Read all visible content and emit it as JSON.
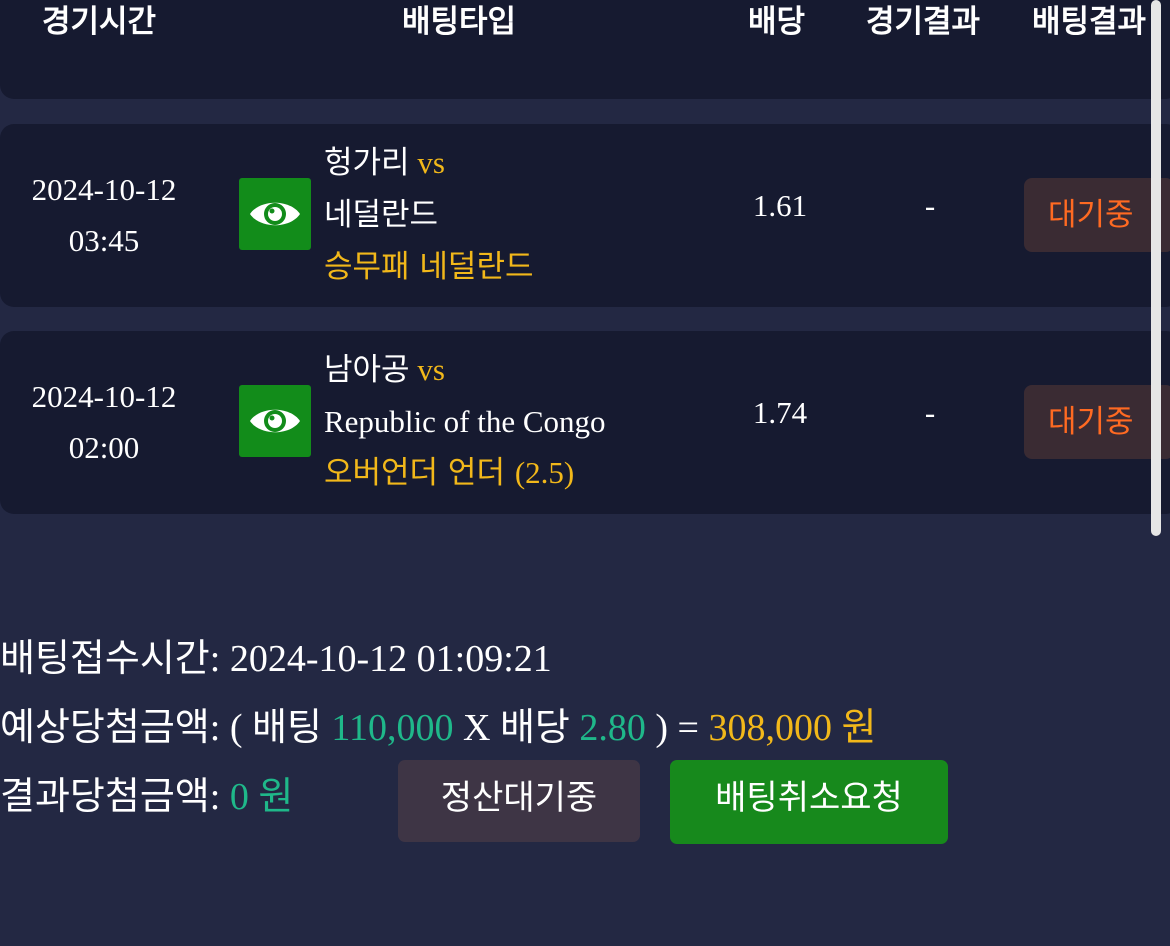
{
  "header": {
    "col_time": "경기시간",
    "col_bet_type": "배팅타입",
    "col_odds": "배당",
    "col_game_result": "경기결과",
    "col_bet_result": "배팅결과"
  },
  "rows": [
    {
      "date": "2024-10-12",
      "time": "03:45",
      "home": "헝가리",
      "vs": "vs",
      "away": "네덜란드",
      "bet_type": "승무패 네덜란드",
      "odds": "1.61",
      "game_result": "-",
      "bet_result": "대기중",
      "icon": "eye-icon"
    },
    {
      "date": "2024-10-12",
      "time": "02:00",
      "home": "남아공",
      "vs": "vs",
      "away": "Republic of the Congo",
      "bet_type_ko": "오버언더 언더 ",
      "bet_type_num": "(2.5)",
      "odds": "1.74",
      "game_result": "-",
      "bet_result": "대기중",
      "icon": "eye-icon"
    }
  ],
  "summary": {
    "received_label": "배팅접수시간",
    "received_value": ": 2024-10-12 01:09:21",
    "expected_label": "예상당첨금액",
    "expected_prefix": ": ( ",
    "bet_word": "배팅",
    "bet_amount": "110,000",
    "times": "X",
    "odds_word": "배당",
    "odds_value": "2.80",
    "equals": ") =",
    "expected_amount": "308,000",
    "won_unit": "원",
    "result_label": "결과당첨금액",
    "result_sep": ":",
    "result_amount": "0",
    "result_unit": "원"
  },
  "buttons": {
    "settle_wait": "정산대기중",
    "cancel_request": "배팅취소요청"
  },
  "colors": {
    "background": "#232843",
    "card": "#161a30",
    "accent_gold": "#f2b81a",
    "accent_teal": "#1fb88a",
    "status_orange": "#ff6a22",
    "green_button": "#17891c"
  }
}
